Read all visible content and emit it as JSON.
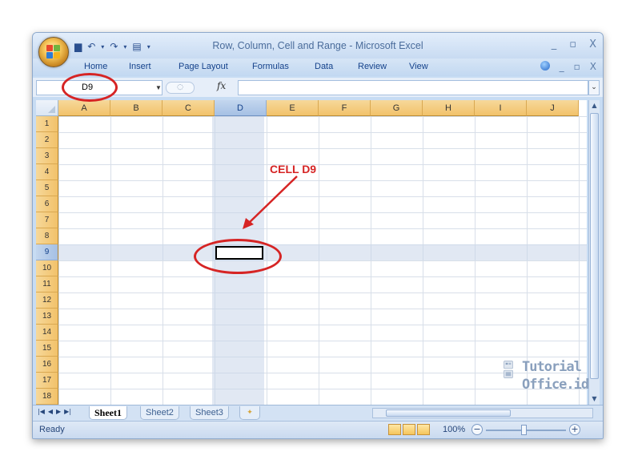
{
  "window": {
    "title": "Row, Column, Cell and Range - Microsoft Excel",
    "controls": [
      "_",
      "▫",
      "X"
    ]
  },
  "ribbon": {
    "tabs": [
      "Home",
      "Insert",
      "Page Layout",
      "Formulas",
      "Data",
      "Review",
      "View"
    ],
    "active_tab": "Home",
    "right_controls": [
      "_",
      "▫",
      "X"
    ]
  },
  "formula_bar": {
    "name_box": "D9",
    "fx": "fx",
    "formula": ""
  },
  "grid": {
    "columns": [
      "A",
      "B",
      "C",
      "D",
      "E",
      "F",
      "G",
      "H",
      "I",
      "J"
    ],
    "rows": [
      "1",
      "2",
      "3",
      "4",
      "5",
      "6",
      "7",
      "8",
      "9",
      "10",
      "11",
      "12",
      "13",
      "14",
      "15",
      "16",
      "17",
      "18"
    ],
    "selected_column": "D",
    "selected_row": "9",
    "active_cell": "D9"
  },
  "sheets": {
    "tabs": [
      "Sheet1",
      "Sheet2",
      "Sheet3"
    ],
    "active": "Sheet1"
  },
  "status": {
    "text": "Ready",
    "zoom": "100%"
  },
  "annotation": {
    "label": "CELL D9",
    "color": "#d62424"
  },
  "watermark": {
    "line1": "Tutorial",
    "line2": "Office.id"
  },
  "colors": {
    "header_orange": "#f2c26a",
    "header_selected": "#a5c0e4",
    "chrome_blue": "#c7dcf3"
  }
}
